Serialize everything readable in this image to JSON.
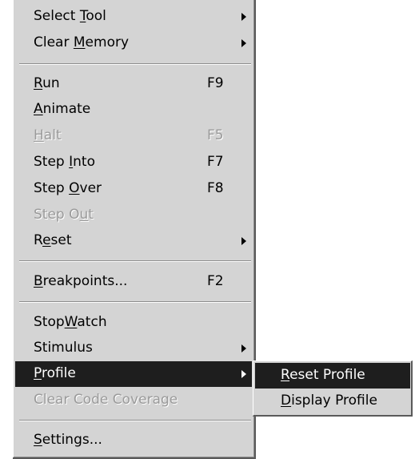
{
  "menu": {
    "items": [
      {
        "pre": "Select ",
        "key": "T",
        "post": "ool",
        "shortcut": "",
        "submenu": true,
        "disabled": false
      },
      {
        "pre": "Clear ",
        "key": "M",
        "post": "emory",
        "shortcut": "",
        "submenu": true,
        "disabled": false
      },
      {
        "pre": "",
        "key": "R",
        "post": "un",
        "shortcut": "F9",
        "submenu": false,
        "disabled": false
      },
      {
        "pre": "",
        "key": "A",
        "post": "nimate",
        "shortcut": "",
        "submenu": false,
        "disabled": false
      },
      {
        "pre": "",
        "key": "H",
        "post": "alt",
        "shortcut": "F5",
        "submenu": false,
        "disabled": true
      },
      {
        "pre": "Step ",
        "key": "I",
        "post": "nto",
        "shortcut": "F7",
        "submenu": false,
        "disabled": false
      },
      {
        "pre": "Step ",
        "key": "O",
        "post": "ver",
        "shortcut": "F8",
        "submenu": false,
        "disabled": false
      },
      {
        "pre": "Step O",
        "key": "u",
        "post": "t",
        "shortcut": "",
        "submenu": false,
        "disabled": true
      },
      {
        "pre": "R",
        "key": "e",
        "post": "set",
        "shortcut": "",
        "submenu": true,
        "disabled": false
      },
      {
        "pre": "",
        "key": "B",
        "post": "reakpoints...",
        "shortcut": "F2",
        "submenu": false,
        "disabled": false
      },
      {
        "pre": "Stop",
        "key": "W",
        "post": "atch",
        "shortcut": "",
        "submenu": false,
        "disabled": false
      },
      {
        "pre": "Stimulus",
        "key": "",
        "post": "",
        "shortcut": "",
        "submenu": true,
        "disabled": false
      },
      {
        "pre": "",
        "key": "P",
        "post": "rofile",
        "shortcut": "",
        "submenu": true,
        "disabled": false,
        "highlighted": true
      },
      {
        "pre": "Clear Code Coverage",
        "key": "",
        "post": "",
        "shortcut": "",
        "submenu": false,
        "disabled": true
      },
      {
        "pre": "",
        "key": "S",
        "post": "ettings...",
        "shortcut": "",
        "submenu": false,
        "disabled": false
      }
    ]
  },
  "submenu": {
    "items": [
      {
        "pre": "",
        "key": "R",
        "post": "eset Profile",
        "highlighted": true
      },
      {
        "pre": "",
        "key": "D",
        "post": "isplay Profile",
        "highlighted": false
      }
    ]
  },
  "colors": {
    "menu_bg": "#d4d4d4",
    "highlight_bg": "#1e1e1e",
    "highlight_text": "#ffffff",
    "disabled_text": "#9a9a9a"
  },
  "icons": {
    "submenu_arrow": "submenu-arrow-icon"
  }
}
